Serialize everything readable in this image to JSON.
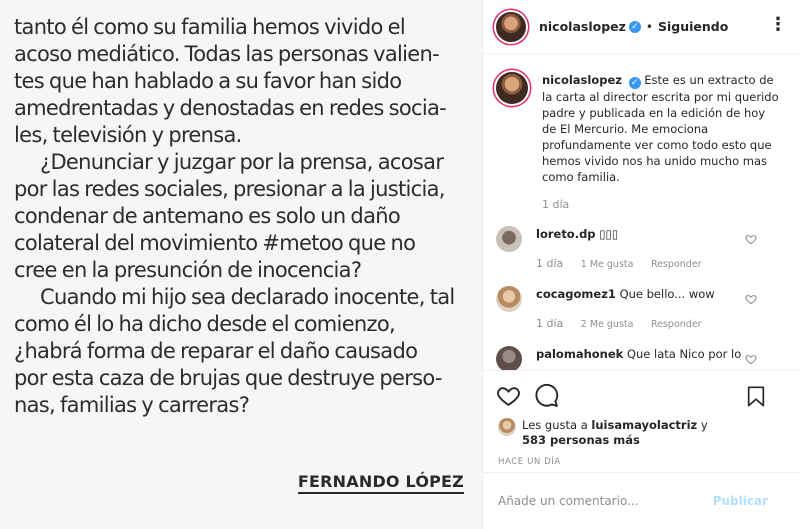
{
  "letter": {
    "lines": [
      "tanto él como su familia hemos vivido el",
      "acoso mediático. Todas las personas valien-",
      "tes que han hablado a su favor han sido",
      "amedrentadas y denostadas en redes socia-",
      "les, televisión y prensa.",
      "¿Denunciar y juzgar por la prensa, acosar",
      "por las redes sociales, presionar a la justicia,",
      "condenar de antemano es solo un daño",
      "colateral del movimiento #metoo que no",
      "cree en la presunción de inocencia?",
      "Cuando mi hijo sea declarado inocente, tal",
      "como él lo ha dicho desde el comienzo,",
      "¿habrá forma de reparar el daño causado",
      "por esta caza de brujas que destruye perso-",
      "nas, familias y carreras?"
    ],
    "signature": "FERNANDO LÓPEZ"
  },
  "header": {
    "username": "nicolaslopez",
    "verified_icon": "✓",
    "separator": "•",
    "follow_status": "Siguiendo",
    "more_icon": "⋮"
  },
  "caption": {
    "username": "nicolaslopez",
    "text": "Este es un extracto de la carta al director escrita por mi querido padre y publicada en la edición de hoy de El Mercurio. Me emociona profundamente ver como todo esto que hemos vivido nos ha unido mucho mas como familia.",
    "time": "1 día"
  },
  "comments": [
    {
      "username": "loreto.dp",
      "text": "▯▯▯",
      "time": "1 día",
      "likes": "1 Me gusta",
      "reply": "Responder"
    },
    {
      "username": "cocagomez1",
      "text": "Que bello... wow",
      "time": "1 día",
      "likes": "2 Me gusta",
      "reply": "Responder"
    },
    {
      "username": "palomahonek",
      "text": "Que lata Nico por lo",
      "time": "",
      "likes": "",
      "reply": ""
    }
  ],
  "likes": {
    "prefix": "Les gusta a",
    "user": "luisamayolactriz",
    "conj": "y",
    "count": "583 personas más"
  },
  "time_ago": "HACE UN DÍA",
  "add_comment": {
    "placeholder": "Añade un comentario...",
    "publish": "Publicar"
  }
}
